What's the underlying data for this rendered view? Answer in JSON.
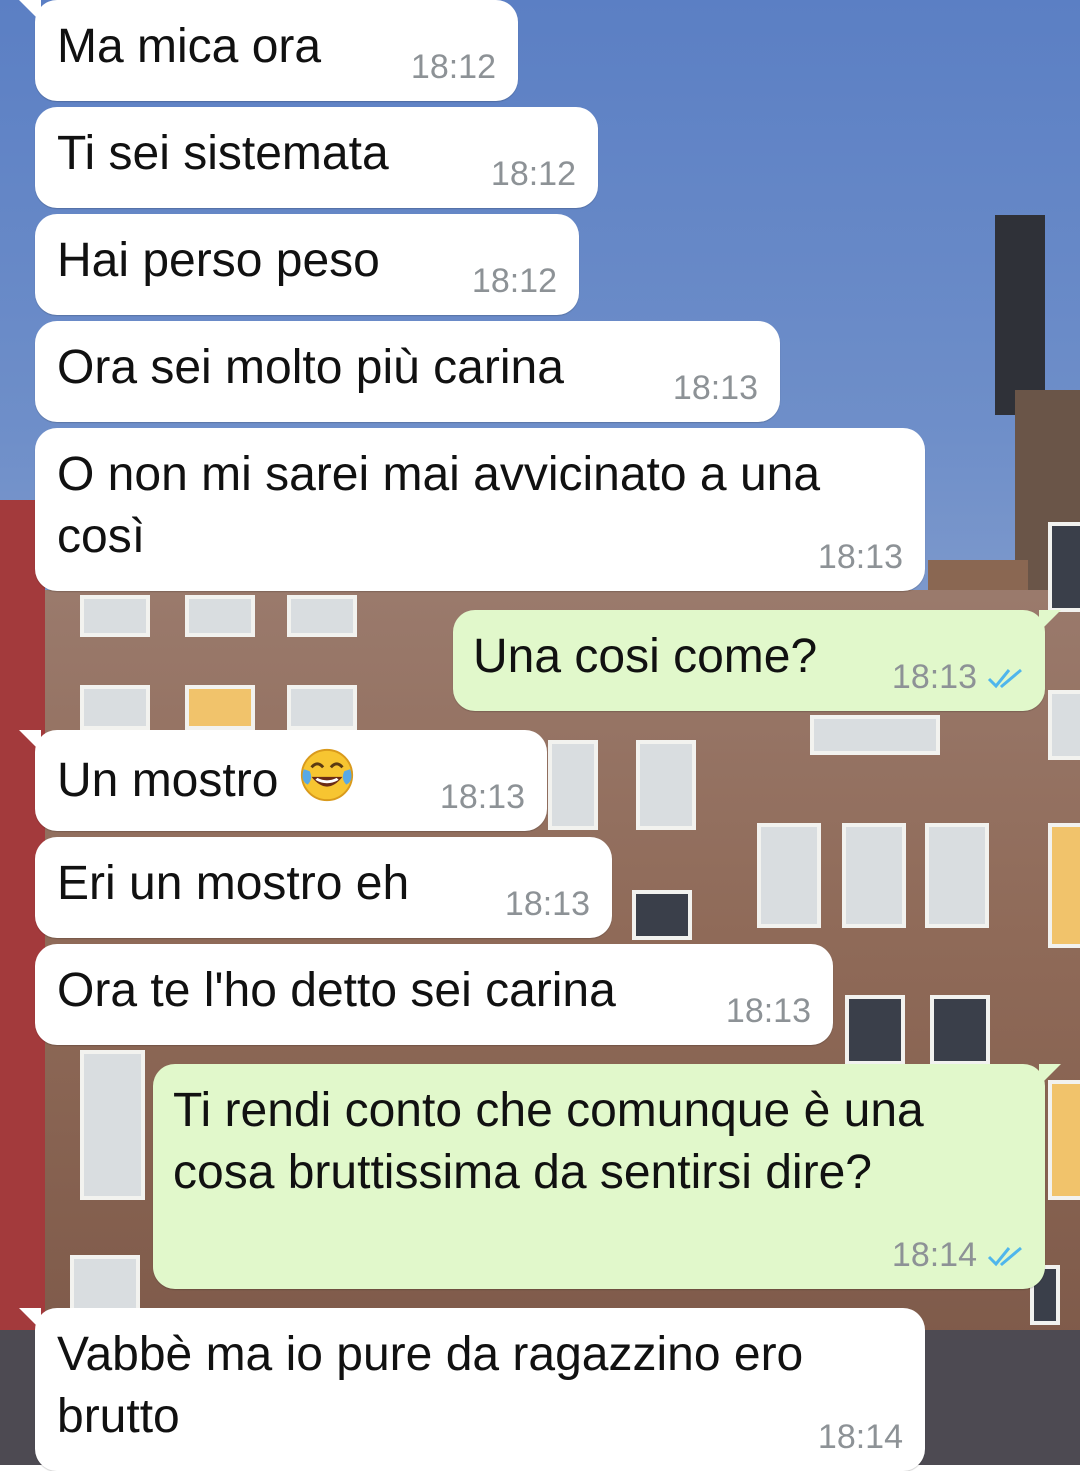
{
  "colors": {
    "incoming_bubble": "#ffffff",
    "outgoing_bubble": "#e1f8cb",
    "timestamp": "#8d9296",
    "read_ticks": "#4fb6ec"
  },
  "messages": [
    {
      "direction": "incoming",
      "lines": [
        "Ma mica ora"
      ],
      "time": "18:12"
    },
    {
      "direction": "incoming",
      "lines": [
        "Ti sei sistemata"
      ],
      "time": "18:12"
    },
    {
      "direction": "incoming",
      "lines": [
        "Hai perso peso"
      ],
      "time": "18:12"
    },
    {
      "direction": "incoming",
      "lines": [
        "Ora sei molto più carina"
      ],
      "time": "18:13"
    },
    {
      "direction": "incoming",
      "lines": [
        "O non mi sarei mai avvicinato a una",
        "così"
      ],
      "time": "18:13"
    },
    {
      "direction": "outgoing",
      "lines": [
        "Una cosi come?"
      ],
      "time": "18:13",
      "status": "read-double-check-icon"
    },
    {
      "direction": "incoming",
      "lines": [
        "Un mostro"
      ],
      "emoji": "tears-of-joy-emoji-icon",
      "time": "18:13"
    },
    {
      "direction": "incoming",
      "lines": [
        "Eri un mostro eh"
      ],
      "time": "18:13"
    },
    {
      "direction": "incoming",
      "lines": [
        "Ora te l'ho detto sei carina"
      ],
      "time": "18:13"
    },
    {
      "direction": "outgoing",
      "lines": [
        "Ti rendi conto che comunque è una",
        "cosa bruttissima da sentirsi dire?"
      ],
      "time": "18:14",
      "status": "read-double-check-icon"
    },
    {
      "direction": "incoming",
      "lines": [
        "Vabbè ma io pure da ragazzino ero",
        "brutto"
      ],
      "time": "18:14"
    }
  ]
}
